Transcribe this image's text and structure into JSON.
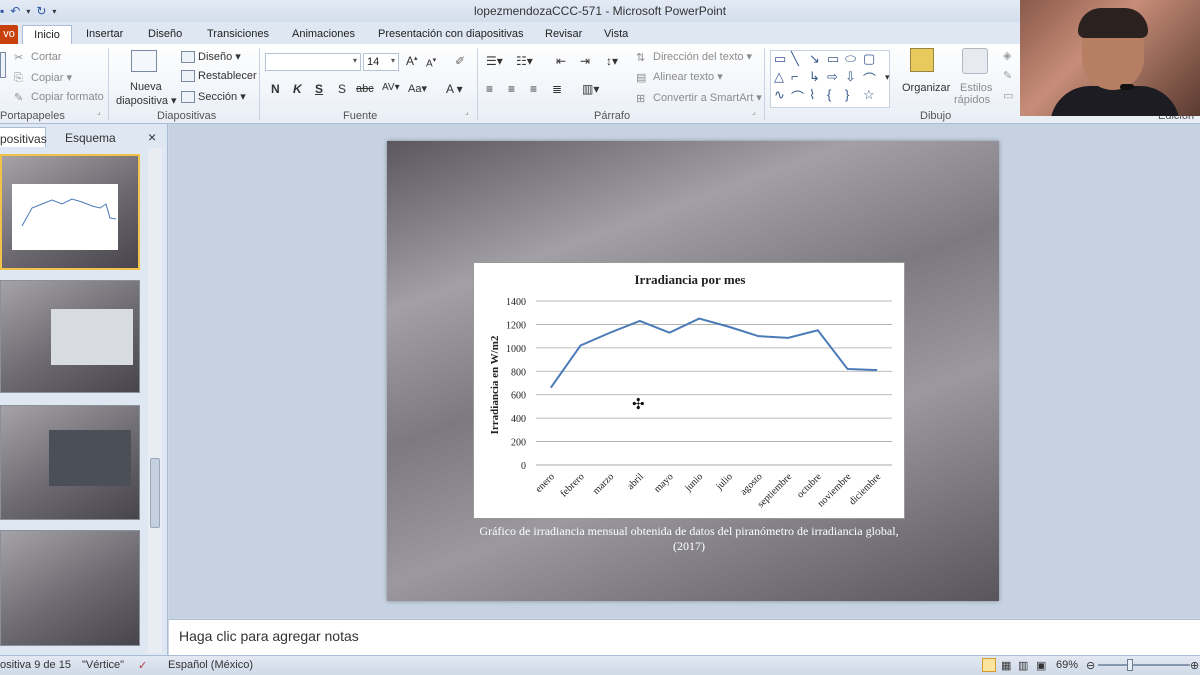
{
  "window": {
    "title": "lopezmendozaCCC-571  -  Microsoft PowerPoint"
  },
  "tabs": [
    {
      "label": "vo"
    },
    {
      "label": "Inicio"
    },
    {
      "label": "Insertar"
    },
    {
      "label": "Diseño"
    },
    {
      "label": "Transiciones"
    },
    {
      "label": "Animaciones"
    },
    {
      "label": "Presentación con diapositivas"
    },
    {
      "label": "Revisar"
    },
    {
      "label": "Vista"
    }
  ],
  "ribbon": {
    "clipboard": {
      "cut": "Cortar",
      "copy": "Copiar",
      "format": "Copiar formato",
      "label": "Portapapeles"
    },
    "slides": {
      "new": "Nueva",
      "new2": "diapositiva",
      "layout": "Diseño",
      "reset": "Restablecer",
      "section": "Sección",
      "label": "Diapositivas"
    },
    "font": {
      "size": "14",
      "label": "Fuente"
    },
    "paragraph": {
      "direction": "Dirección del texto",
      "align": "Alinear texto",
      "smartart": "Convertir a SmartArt",
      "label": "Párrafo"
    },
    "drawing": {
      "arrange": "Organizar",
      "styles": "Estilos",
      "styles2": "rápidos",
      "label": "Dibujo"
    },
    "editing": {
      "label": "Edición"
    }
  },
  "panel": {
    "tab_slides": "positivas",
    "tab_outline": "Esquema",
    "close": "×"
  },
  "chart_data": {
    "type": "line",
    "title": "Irradiancia por mes",
    "xlabel": "",
    "ylabel": "Irradiancia en W/m2",
    "categories": [
      "enero",
      "febrero",
      "marzo",
      "abril",
      "mayo",
      "junio",
      "julio",
      "agosto",
      "septiembre",
      "octubre",
      "noviembre",
      "diciembre"
    ],
    "values": [
      660,
      1020,
      1130,
      1230,
      1130,
      1250,
      1180,
      1100,
      1085,
      1150,
      820,
      810
    ],
    "ylim": [
      0,
      1400
    ],
    "yticks": [
      "0",
      "200",
      "400",
      "600",
      "800",
      "1000",
      "1200",
      "1400"
    ],
    "grid": true,
    "color": "#4a7ab8"
  },
  "slide": {
    "caption": "Gráfico de irradiancia  mensual obtenida de datos del piranómetro de irradiancia global, (2017)"
  },
  "notes": {
    "placeholder": "Haga clic para agregar notas"
  },
  "status": {
    "slide": "ositiva 9 de 15",
    "theme": "\"Vértice\"",
    "language": "Español (México)",
    "zoom": "69%"
  }
}
